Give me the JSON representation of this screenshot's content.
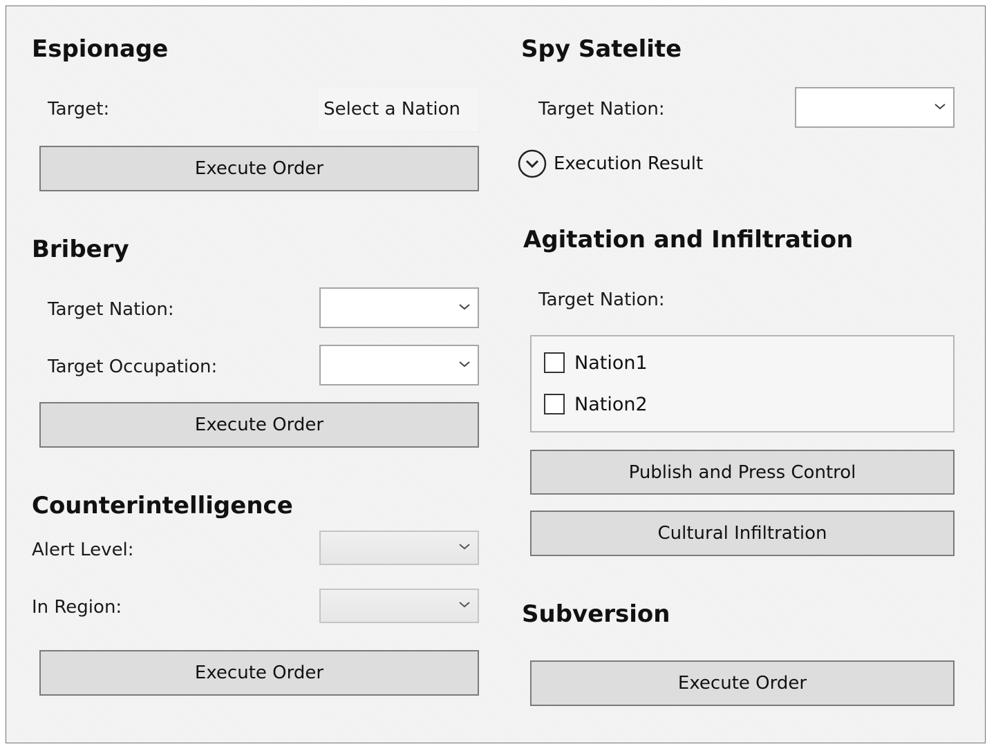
{
  "espionage": {
    "title": "Espionage",
    "target_label": "Target:",
    "target_button": "Select a Nation",
    "execute_label": "Execute Order"
  },
  "bribery": {
    "title": "Bribery",
    "target_nation_label": "Target Nation:",
    "target_occupation_label": "Target Occupation:",
    "execute_label": "Execute Order"
  },
  "counterintelligence": {
    "title": "Counterintelligence",
    "alert_level_label": "Alert Level:",
    "in_region_label": "In Region:",
    "execute_label": "Execute Order"
  },
  "spy_satellite": {
    "title": "Spy Satelite",
    "target_nation_label": "Target Nation:",
    "execution_result_label": "Execution Result"
  },
  "agitation": {
    "title": "Agitation and Infiltration",
    "target_nation_label": "Target Nation:",
    "nations": [
      "Nation1",
      "Nation2"
    ],
    "publish_label": "Publish and Press Control",
    "cultural_label": "Cultural Infiltration"
  },
  "subversion": {
    "title": "Subversion",
    "execute_label": "Execute Order"
  },
  "icons": {
    "dropdown": "chevron-down-icon",
    "expander": "circle-chevron-down-icon"
  },
  "colors": {
    "background": "#f4f4f4",
    "button_face": "#dddddd",
    "button_border": "#7a7a7a"
  }
}
